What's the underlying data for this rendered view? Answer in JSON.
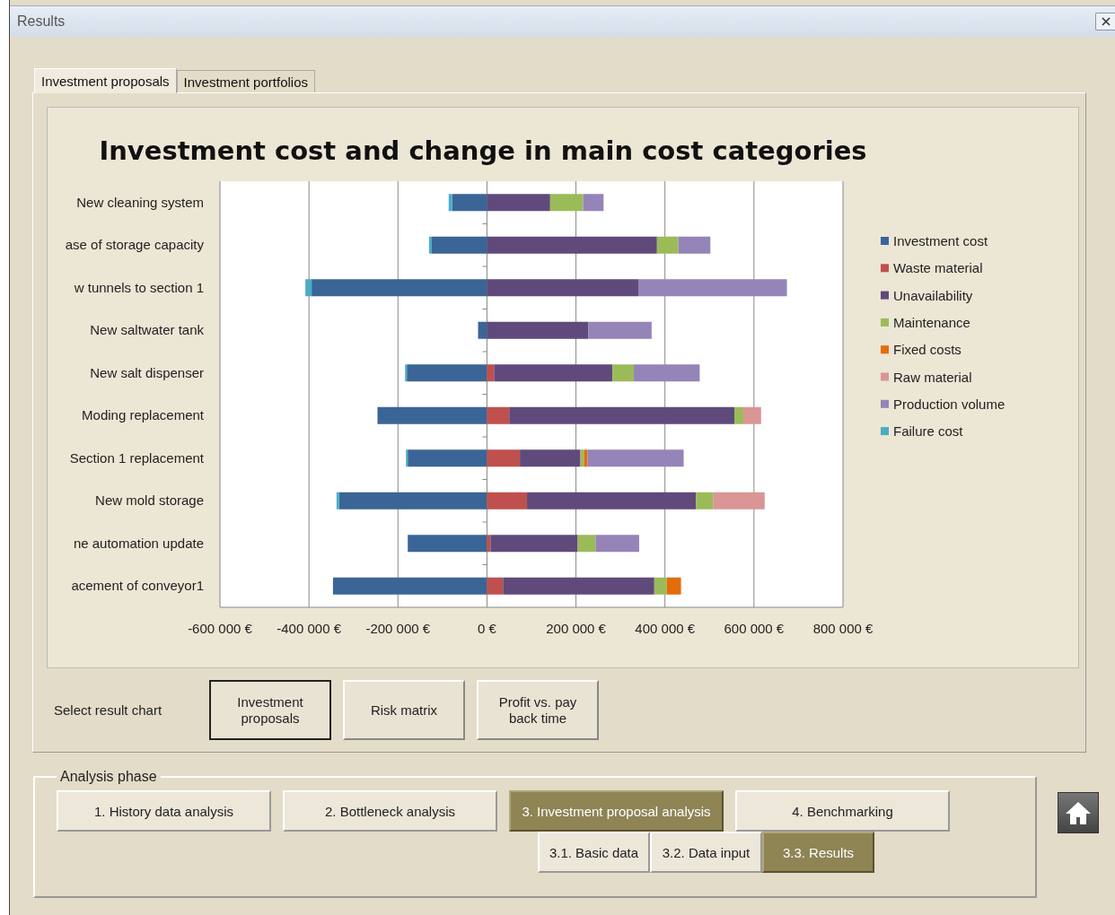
{
  "window": {
    "title": "Results"
  },
  "tabs": [
    {
      "label": "Investment proposals",
      "selected": true
    },
    {
      "label": "Investment portfolios",
      "selected": false
    }
  ],
  "chart": {
    "chart_data": {
      "type": "bar",
      "orientation": "horizontal",
      "stacked": true,
      "title": "Investment cost and change in main cost categories",
      "categories": [
        "New cleaning system",
        "ase of storage capacity",
        "w tunnels to section 1",
        "New saltwater tank",
        "New salt dispenser",
        "Moding replacement",
        "Section 1 replacement",
        "New mold storage",
        "ne automation update",
        "acement of conveyor1"
      ],
      "series": [
        {
          "name": "Investment cost",
          "color": "#3a6596",
          "values": [
            -78000,
            -124000,
            -394000,
            -20000,
            -180000,
            -246000,
            -178000,
            -332000,
            -178000,
            -346000
          ]
        },
        {
          "name": "Waste material",
          "color": "#c0504d",
          "values": [
            0,
            0,
            0,
            0,
            16000,
            50000,
            74000,
            90000,
            8000,
            36000
          ]
        },
        {
          "name": "Unavailability",
          "color": "#604a7b",
          "values": [
            142000,
            382000,
            340000,
            228000,
            266000,
            506000,
            136000,
            380000,
            196000,
            340000
          ]
        },
        {
          "name": "Maintenance",
          "color": "#9bbb59",
          "values": [
            74000,
            48000,
            0,
            0,
            48000,
            20000,
            8000,
            38000,
            40000,
            28000
          ]
        },
        {
          "name": "Fixed costs",
          "color": "#e46c0a",
          "values": [
            0,
            0,
            0,
            0,
            0,
            0,
            8000,
            0,
            0,
            32000
          ]
        },
        {
          "name": "Raw material",
          "color": "#d99694",
          "values": [
            0,
            0,
            0,
            0,
            0,
            40000,
            0,
            116000,
            0,
            0
          ]
        },
        {
          "name": "Production volume",
          "color": "#9584b8",
          "values": [
            46000,
            72000,
            334000,
            142000,
            148000,
            0,
            216000,
            0,
            98000,
            0
          ]
        },
        {
          "name": "Failure cost",
          "color": "#4bacc6",
          "values": [
            -8000,
            -6000,
            -14000,
            0,
            -4000,
            0,
            -4000,
            -6000,
            0,
            0
          ]
        }
      ],
      "xlim": [
        -600000,
        800000
      ],
      "grid": true,
      "legend": true,
      "xticks": [
        {
          "value": -600000,
          "label": "-600 000 €"
        },
        {
          "value": -400000,
          "label": "-400 000 €"
        },
        {
          "value": -200000,
          "label": "-200 000 €"
        },
        {
          "value": 0,
          "label": "0 €"
        },
        {
          "value": 200000,
          "label": "200 000 €"
        },
        {
          "value": 400000,
          "label": "400 000 €"
        },
        {
          "value": 600000,
          "label": "600 000 €"
        },
        {
          "value": 800000,
          "label": "800 000 €"
        }
      ]
    }
  },
  "result_selector": {
    "label": "Select result chart",
    "buttons": [
      {
        "label": "Investment proposals",
        "selected": true
      },
      {
        "label": "Risk matrix",
        "selected": false
      },
      {
        "label": "Profit vs. pay back time",
        "selected": false
      }
    ]
  },
  "analysis_phase": {
    "title": "Analysis phase",
    "phases": [
      {
        "label": "1. History data analysis",
        "selected": false
      },
      {
        "label": "2. Bottleneck analysis",
        "selected": false
      },
      {
        "label": "3. Investment proposal analysis",
        "selected": true
      },
      {
        "label": "4. Benchmarking",
        "selected": false
      }
    ],
    "subphases": [
      {
        "label": "3.1. Basic data",
        "selected": false
      },
      {
        "label": "3.2. Data input",
        "selected": false
      },
      {
        "label": "3.3. Results",
        "selected": true
      }
    ]
  }
}
